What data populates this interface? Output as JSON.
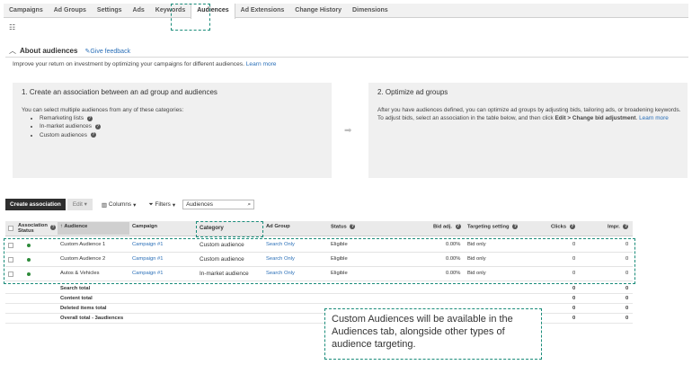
{
  "tabs": [
    "Campaigns",
    "Ad Groups",
    "Settings",
    "Ads",
    "Keywords",
    "Audiences",
    "Ad Extensions",
    "Change History",
    "Dimensions"
  ],
  "active_tab": "Audiences",
  "about": {
    "title": "About audiences",
    "feedback": "Give feedback",
    "intro": "Improve your return on investment by optimizing your campaigns for different audiences.",
    "learn_more": "Learn more"
  },
  "panel1": {
    "title": "1. Create an association between an ad group and audiences",
    "text": "You can select multiple audiences from any of these categories:",
    "items": [
      "Remarketing lists",
      "In-market audiences",
      "Custom audiences"
    ]
  },
  "panel2": {
    "title": "2. Optimize ad groups",
    "text": "After you have audiences defined, you can optimize ad groups by adjusting bids, tailoring ads, or broadening keywords. To adjust bids, select an association in the table below, and then click",
    "bold": "Edit > Change bid adjustment",
    "learn_more": "Learn more"
  },
  "toolbar": {
    "create": "Create association",
    "edit": "Edit",
    "columns": "Columns",
    "filters": "Filters",
    "search_value": "Audiences"
  },
  "table": {
    "headers": {
      "status": "Association Status",
      "audience": "Audience",
      "campaign": "Campaign",
      "category": "Category",
      "adgroup": "Ad Group",
      "estatus": "Status",
      "bid": "Bid adj.",
      "targeting": "Targeting setting",
      "clicks": "Clicks",
      "impr": "Impr."
    },
    "rows": [
      {
        "audience": "Custom Audience 1",
        "campaign": "Campaign #1",
        "category": "Custom audience",
        "adgroup": "Search Only",
        "status": "Eligible",
        "bid": "0.00%",
        "targeting": "Bid only",
        "clicks": "0",
        "impr": "0"
      },
      {
        "audience": "Custom Audience 2",
        "campaign": "Campaign #1",
        "category": "Custom audience",
        "adgroup": "Search Only",
        "status": "Eligible",
        "bid": "0.00%",
        "targeting": "Bid only",
        "clicks": "0",
        "impr": "0"
      },
      {
        "audience": "Autos & Vehicles",
        "campaign": "Campaign #1",
        "category": "In-market audience",
        "adgroup": "Search Only",
        "status": "Eligible",
        "bid": "0.00%",
        "targeting": "Bid only",
        "clicks": "0",
        "impr": "0"
      }
    ],
    "totals": [
      {
        "label": "Search total",
        "clicks": "0",
        "impr": "0"
      },
      {
        "label": "Content total",
        "clicks": "0",
        "impr": "0"
      },
      {
        "label": "Deleted items total",
        "clicks": "0",
        "impr": "0"
      },
      {
        "label": "Overall total - 3audiences",
        "clicks": "0",
        "impr": "0"
      }
    ]
  },
  "callout": "Custom Audiences will be available in the Audiences tab, alongside other types of audience targeting.",
  "colors": {
    "accent_dashed": "#1a8c7a",
    "link": "#2a6fb8",
    "status_dot": "#2e8b3a"
  }
}
